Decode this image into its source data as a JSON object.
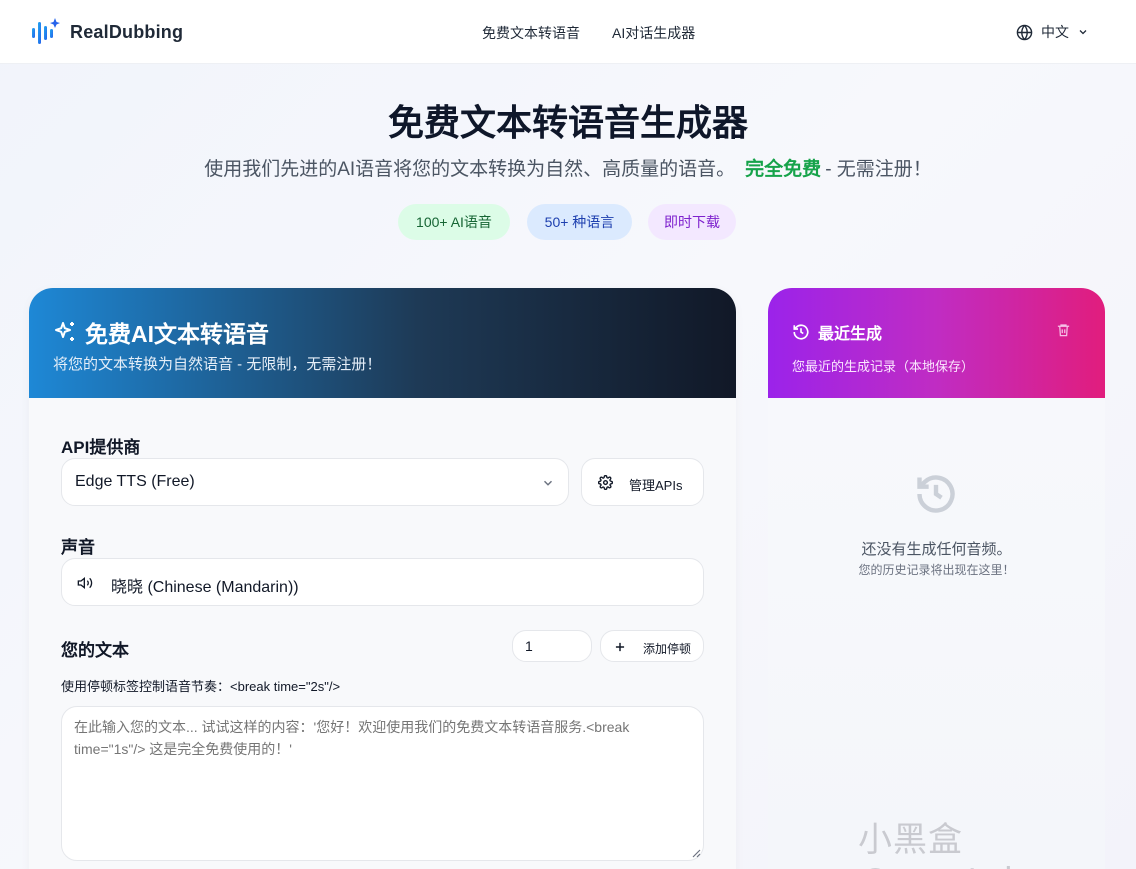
{
  "header": {
    "brand": "RealDubbing",
    "nav": [
      "免费文本转语音",
      "AI对话生成器"
    ],
    "language": "中文"
  },
  "hero": {
    "title": "免费文本转语音生成器",
    "subtitle": "使用我们先进的AI语音将您的文本转换为自然、高质量的语音。",
    "free": "完全免费",
    "free_rest": "- 无需注册！",
    "badges": [
      "100+ AI语音",
      "50+ 种语言",
      "即时下载"
    ]
  },
  "tts_panel": {
    "title": "免费AI文本转语音",
    "subtitle": "将您的文本转换为自然语音 - 无限制，无需注册！",
    "provider_label": "API提供商",
    "provider_value": "Edge TTS (Free)",
    "manage_apis": "管理APIs",
    "voice_label": "声音",
    "voice_value": "晓晓 (Chinese (Mandarin))",
    "text_label": "您的文本",
    "break_seconds": "1",
    "add_break": "添加停顿",
    "hint": "使用停顿标签控制语音节奏：<break time=\"2s\"/>",
    "text_placeholder": "在此输入您的文本... 试试这样的内容：'您好！欢迎使用我们的免费文本转语音服务.<break time=\"1s\"/> 这是完全免费使用的！'"
  },
  "recent_panel": {
    "title": "最近生成",
    "subtitle": "您最近的生成记录（本地保存）",
    "empty_title": "还没有生成任何音频。",
    "empty_sub": "您的历史记录将出现在这里！"
  },
  "watermark": "小黑盒 @crystalz",
  "colors": {
    "free_green": "#16a34a",
    "left_header_start": "#1e88d6",
    "left_header_end": "#111827",
    "right_header_start": "#9b23ea",
    "right_header_end": "#e11d7d"
  }
}
